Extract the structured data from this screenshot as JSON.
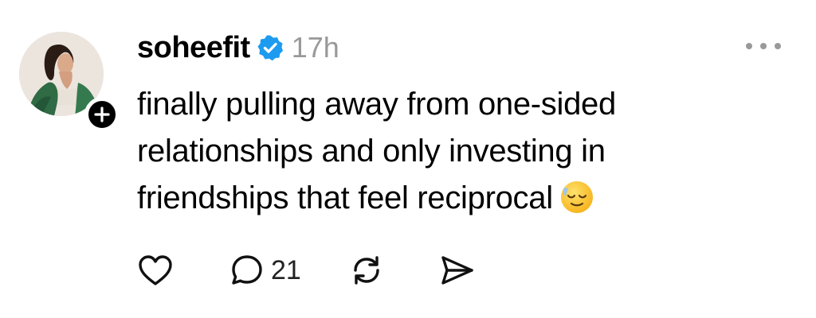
{
  "post": {
    "username": "soheefit",
    "verified": true,
    "time": "17h",
    "text_lines": [
      "finally pulling away from one-sided",
      "relationships and only investing in",
      "friendships that feel reciprocal"
    ],
    "emoji": "relieved-face",
    "reply_count": "21"
  },
  "icons": {
    "verified": "verified-badge-icon",
    "follow": "plus-icon",
    "more": "more-horizontal-icon",
    "like": "heart-icon",
    "reply": "comment-icon",
    "repost": "repost-icon",
    "share": "send-icon"
  },
  "colors": {
    "verified": "#1d9bf0",
    "muted": "#999999",
    "text": "#000000"
  }
}
